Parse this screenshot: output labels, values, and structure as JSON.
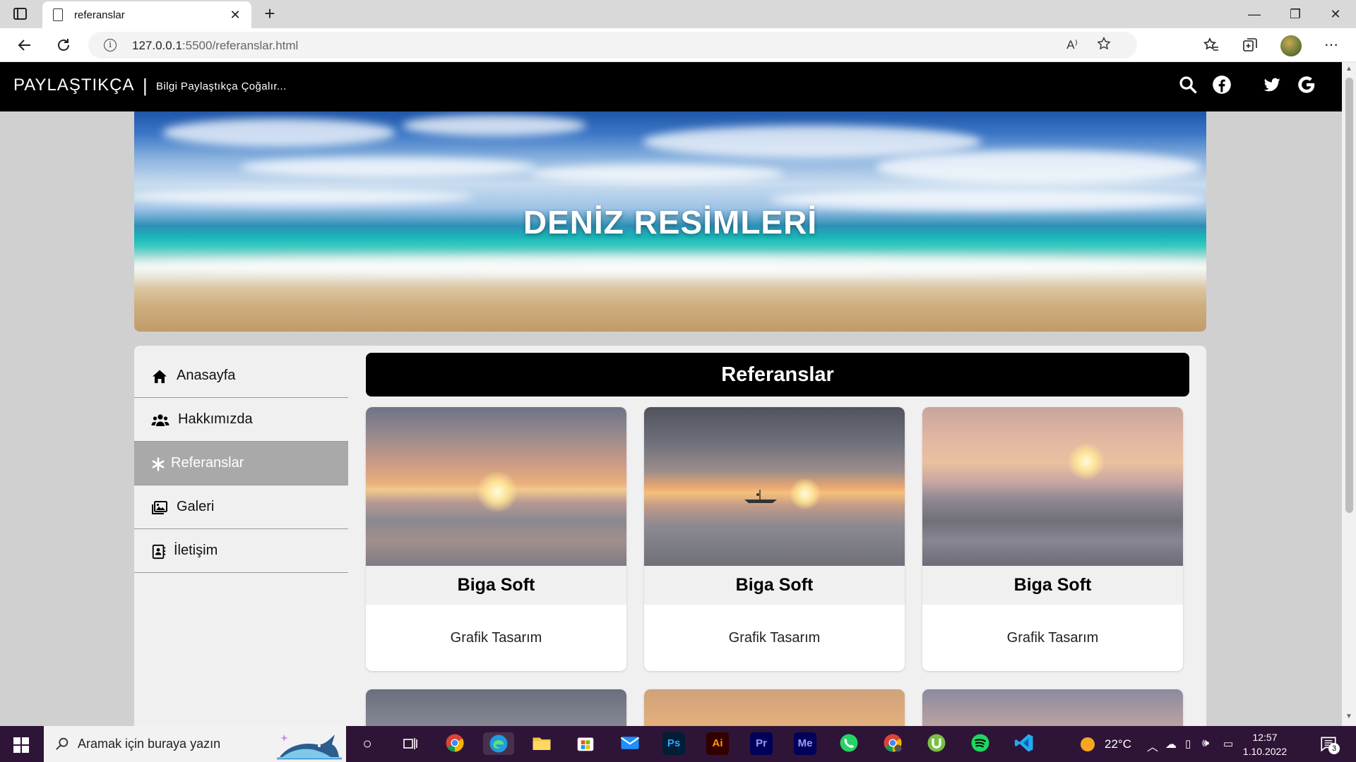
{
  "browser": {
    "tab_title": "referanslar",
    "url_host": "127.0.0.1",
    "url_rest": ":5500/referanslar.html",
    "read_aloud_glyph": "A⁾"
  },
  "site": {
    "brand": "PAYLAŞTIKÇA",
    "separator": "|",
    "tagline": "Bilgi Paylaştıkça Çoğalır..."
  },
  "hero": {
    "title": "DENİZ RESİMLERİ"
  },
  "sidebar": {
    "items": [
      {
        "label": "Anasayfa",
        "icon": "home-icon"
      },
      {
        "label": "Hakkımızda",
        "icon": "users-icon"
      },
      {
        "label": "Referanslar",
        "icon": "asterisk-icon",
        "active": true
      },
      {
        "label": "Galeri",
        "icon": "images-icon"
      },
      {
        "label": "İletişim",
        "icon": "contact-card-icon"
      }
    ]
  },
  "content": {
    "title": "Referanslar",
    "cards": [
      {
        "title": "Biga Soft",
        "subtitle": "Grafik Tasarım"
      },
      {
        "title": "Biga Soft",
        "subtitle": "Grafik Tasarım"
      },
      {
        "title": "Biga Soft",
        "subtitle": "Grafik Tasarım"
      }
    ]
  },
  "taskbar": {
    "search_placeholder": "Aramak için buraya yazın",
    "temperature": "22°C",
    "time": "12:57",
    "date": "1.10.2022",
    "notification_count": "3",
    "apps": {
      "ps": "Ps",
      "ai": "Ai",
      "pr": "Pr",
      "me": "Me"
    }
  },
  "colors": {
    "header_bg": "#000000",
    "taskbar_bg": "#2e1436",
    "active_nav": "#a9a9a9",
    "panel_bg": "#f0f0f0"
  }
}
